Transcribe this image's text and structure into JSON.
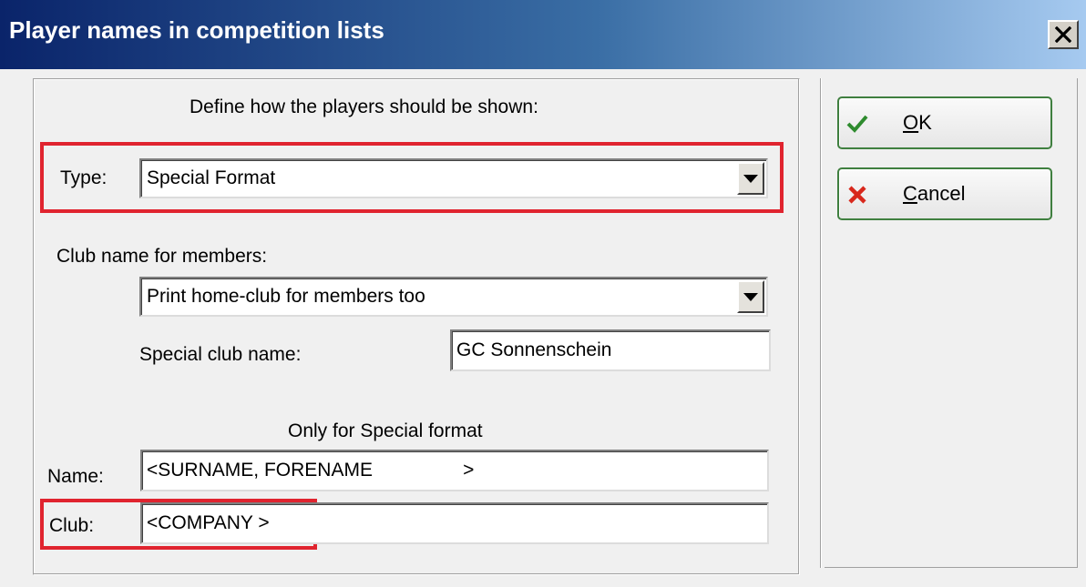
{
  "window": {
    "title": "Player names in competition lists"
  },
  "form": {
    "instruction": "Define how the players should be shown:",
    "type_label": "Type:",
    "type_value": "Special Format",
    "club_section_label": "Club name for members:",
    "club_option_value": "Print home-club for members too",
    "special_club_label": "Special club name:",
    "special_club_value": "GC Sonnenschein",
    "special_format_heading": "Only for Special format",
    "name_label": "Name:",
    "name_value": "<SURNAME, FORENAME                 >",
    "club_label": "Club:",
    "club_value": "<COMPANY >"
  },
  "buttons": {
    "ok": {
      "mnemonic": "O",
      "rest": "K",
      "icon": "checkmark-icon"
    },
    "cancel": {
      "mnemonic": "C",
      "rest": "ancel",
      "icon": "cross-icon"
    }
  },
  "colors": {
    "highlight": "#e0242f",
    "ok_check": "#2e8b2e",
    "cancel_cross": "#d8281c",
    "button_border": "#3f7f3f"
  }
}
